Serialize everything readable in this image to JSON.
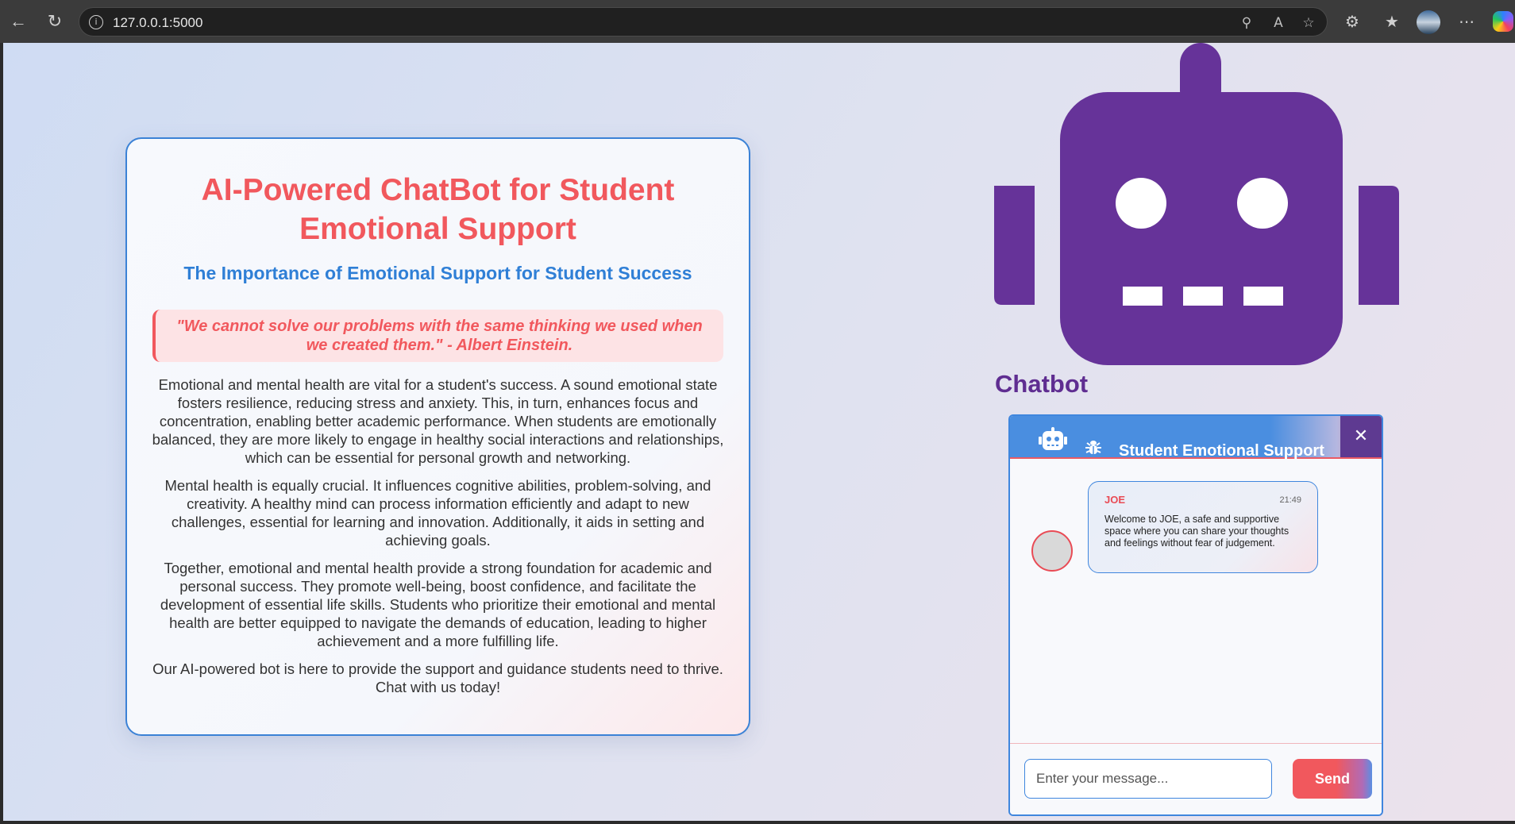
{
  "browser": {
    "url": "127.0.0.1:5000"
  },
  "card": {
    "title": "AI-Powered ChatBot for Student Emotional Support",
    "subtitle": "The Importance of Emotional Support for Student Success",
    "quote": "\"We cannot solve our problems with the same thinking we used when we created them.\" - Albert Einstein.",
    "paragraphs": [
      "Emotional and mental health are vital for a student's success. A sound emotional state fosters resilience, reducing stress and anxiety. This, in turn, enhances focus and concentration, enabling better academic performance. When students are emotionally balanced, they are more likely to engage in healthy social interactions and relationships, which can be essential for personal growth and networking.",
      "Mental health is equally crucial. It influences cognitive abilities, problem-solving, and creativity. A healthy mind can process information efficiently and adapt to new challenges, essential for learning and innovation. Additionally, it aids in setting and achieving goals.",
      "Together, emotional and mental health provide a strong foundation for academic and personal success. They promote well-being, boost confidence, and facilitate the development of essential life skills. Students who prioritize their emotional and mental health are better equipped to navigate the demands of education, leading to higher achievement and a more fulfilling life.",
      "Our AI-powered bot is here to provide the support and guidance students need to thrive. Chat with us today!"
    ]
  },
  "robot": {
    "label": "Chatbot",
    "color": "#663399"
  },
  "chat": {
    "title": "Student Emotional Support",
    "close_symbol": "✕",
    "message": {
      "sender": "JOE",
      "time": "21:49",
      "text": "Welcome to JOE, a safe and supportive space where you can share your thoughts and feelings without fear of judgement."
    },
    "input_placeholder": "Enter your message...",
    "send_label": "Send"
  },
  "colors": {
    "accent_red": "#f1585d",
    "accent_blue": "#3b82d6",
    "robot_purple": "#663399"
  }
}
